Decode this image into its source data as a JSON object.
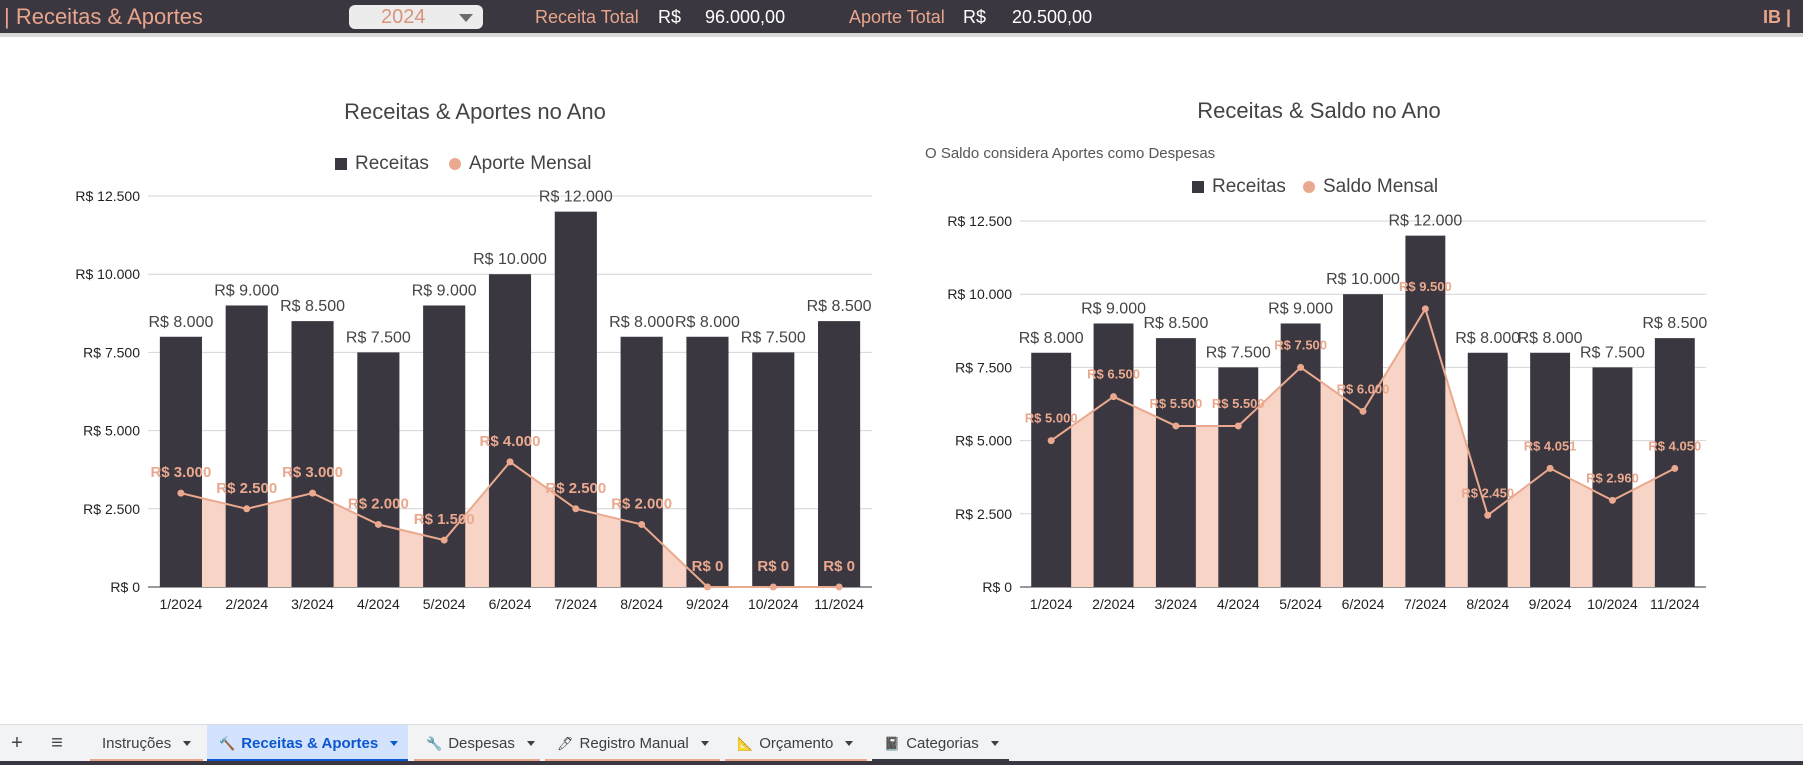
{
  "header": {
    "title": "| Receitas & Aportes",
    "year": "2024",
    "receita_label": "Receita Total",
    "receita_currency": "R$",
    "receita_value": "96.000,00",
    "aporte_label": "Aporte Total",
    "aporte_currency": "R$",
    "aporte_value": "20.500,00",
    "tag": "IB |"
  },
  "colors": {
    "bar": "#3b3740",
    "accent": "#eaa98e",
    "area": "#f7d4c6",
    "header_bg": "#3b3740"
  },
  "chart_data": [
    {
      "type": "bar",
      "title": "Receitas & Aportes no Ano",
      "subtitle": "",
      "categories": [
        "1/2024",
        "2/2024",
        "3/2024",
        "4/2024",
        "5/2024",
        "6/2024",
        "7/2024",
        "8/2024",
        "9/2024",
        "10/2024",
        "11/2024"
      ],
      "series": [
        {
          "name": "Receitas",
          "kind": "bar",
          "values": [
            8000,
            9000,
            8500,
            7500,
            9000,
            10000,
            12000,
            8000,
            8000,
            7500,
            8500
          ],
          "labels": [
            "R$ 8.000",
            "R$ 9.000",
            "R$ 8.500",
            "R$ 7.500",
            "R$ 9.000",
            "R$ 10.000",
            "R$ 12.000",
            "R$ 8.000",
            "R$ 8.000",
            "R$ 7.500",
            "R$ 8.500"
          ]
        },
        {
          "name": "Aporte Mensal",
          "kind": "line-area",
          "values": [
            3000,
            2500,
            3000,
            2000,
            1500,
            4000,
            2500,
            2000,
            0,
            0,
            0
          ],
          "labels": [
            "R$ 3.000",
            "R$ 2.500",
            "R$ 3.000",
            "R$ 2.000",
            "R$ 1.500",
            "R$ 4.000",
            "R$ 2.500",
            "R$ 2.000",
            "R$ 0",
            "R$ 0",
            "R$ 0"
          ]
        }
      ],
      "ylim": [
        0,
        12500
      ],
      "yticks": [
        0,
        2500,
        5000,
        7500,
        10000,
        12500
      ],
      "ytick_labels": [
        "R$ 0",
        "R$ 2.500",
        "R$ 5.000",
        "R$ 7.500",
        "R$ 10.000",
        "R$ 12.500"
      ],
      "grid": true,
      "legend": "top-center"
    },
    {
      "type": "bar",
      "title": "Receitas & Saldo no Ano",
      "subtitle": "O Saldo considera Aportes como Despesas",
      "categories": [
        "1/2024",
        "2/2024",
        "3/2024",
        "4/2024",
        "5/2024",
        "6/2024",
        "7/2024",
        "8/2024",
        "9/2024",
        "10/2024",
        "11/2024"
      ],
      "series": [
        {
          "name": "Receitas",
          "kind": "bar",
          "values": [
            8000,
            9000,
            8500,
            7500,
            9000,
            10000,
            12000,
            8000,
            8000,
            7500,
            8500
          ],
          "labels": [
            "R$ 8.000",
            "R$ 9.000",
            "R$ 8.500",
            "R$ 7.500",
            "R$ 9.000",
            "R$ 10.000",
            "R$ 12.000",
            "R$ 8.000",
            "R$ 8.000",
            "R$ 7.500",
            "R$ 8.500"
          ]
        },
        {
          "name": "Saldo Mensal",
          "kind": "line-area",
          "values": [
            5000,
            6500,
            5500,
            5500,
            7500,
            6000,
            9500,
            2450,
            4051,
            2960,
            4050
          ],
          "labels": [
            "R$ 5.000",
            "R$ 6.500",
            "R$ 5.500",
            "R$ 5.500",
            "R$ 7.500",
            "R$ 6.000",
            "R$ 9.500",
            "R$ 2.450",
            "R$ 4.051",
            "R$ 2.960",
            "R$ 4.050"
          ]
        }
      ],
      "ylim": [
        0,
        12500
      ],
      "yticks": [
        0,
        2500,
        5000,
        7500,
        10000,
        12500
      ],
      "ytick_labels": [
        "R$ 0",
        "R$ 2.500",
        "R$ 5.000",
        "R$ 7.500",
        "R$ 10.000",
        "R$ 12.500"
      ],
      "grid": true,
      "legend": "top-center"
    }
  ],
  "sheet_tabs": [
    {
      "label": "Instruções",
      "icon": "",
      "icon_name": "",
      "active": false,
      "underline": "#eaa98e"
    },
    {
      "label": "Receitas & Aportes",
      "icon": "🔨",
      "icon_name": "hammer-icon",
      "active": true,
      "underline": "#0b57d0"
    },
    {
      "label": "Despesas",
      "icon": "🔧",
      "icon_name": "wrench-icon",
      "active": false,
      "underline": "#eaa98e"
    },
    {
      "label": "Registro Manual",
      "icon": "🖊",
      "icon_name": "pen-icon",
      "active": false,
      "underline": "#eaa98e"
    },
    {
      "label": "Orçamento",
      "icon": "📐",
      "icon_name": "ruler-icon",
      "active": false,
      "underline": "#eaa98e"
    },
    {
      "label": "Categorias",
      "icon": "📓",
      "icon_name": "notebook-icon",
      "active": false,
      "underline": "#3b3740"
    }
  ],
  "sheetbar": {
    "add": "+",
    "menu": "≡"
  }
}
